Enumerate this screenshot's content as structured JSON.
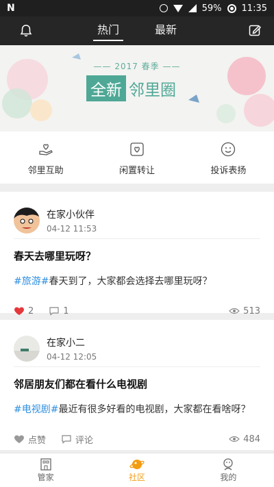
{
  "status_bar": {
    "brand": "N",
    "battery": "59%",
    "time": "11:35"
  },
  "top_nav": {
    "tabs": [
      {
        "label": "热门"
      },
      {
        "label": "最新"
      }
    ]
  },
  "banner": {
    "subtitle": "—— 2017 春季 ——",
    "title_highlight": "全新",
    "title_rest": "邻里圈"
  },
  "quick_actions": [
    {
      "label": "邻里互助",
      "icon": "heart-hand-icon"
    },
    {
      "label": "闲置转让",
      "icon": "heart-box-icon"
    },
    {
      "label": "投诉表扬",
      "icon": "smile-icon"
    }
  ],
  "posts": [
    {
      "author": "在家小伙伴",
      "time": "04-12 11:53",
      "title": "春天去哪里玩呀？",
      "tag": "#旅游#",
      "body": "春天到了，大家都会选择去哪里玩呀？",
      "likes": "2",
      "comments": "1",
      "views": "513",
      "liked": true
    },
    {
      "author": "在家小二",
      "time": "04-12 12:05",
      "title": "邻居朋友们都在看什么电视剧",
      "tag": "#电视剧#",
      "body": "最近有很多好看的电视剧，大家都在看啥呀？",
      "likes": "点赞",
      "comments": "评论",
      "views": "484",
      "liked": false
    }
  ],
  "tabbar": [
    {
      "label": "管家",
      "icon": "building-icon"
    },
    {
      "label": "社区",
      "icon": "planet-icon"
    },
    {
      "label": "我的",
      "icon": "profile-icon"
    }
  ],
  "colors": {
    "accent": "#f39c12",
    "tag": "#2e8fe0",
    "banner_green": "#4fa896",
    "like_red": "#e5383b"
  }
}
